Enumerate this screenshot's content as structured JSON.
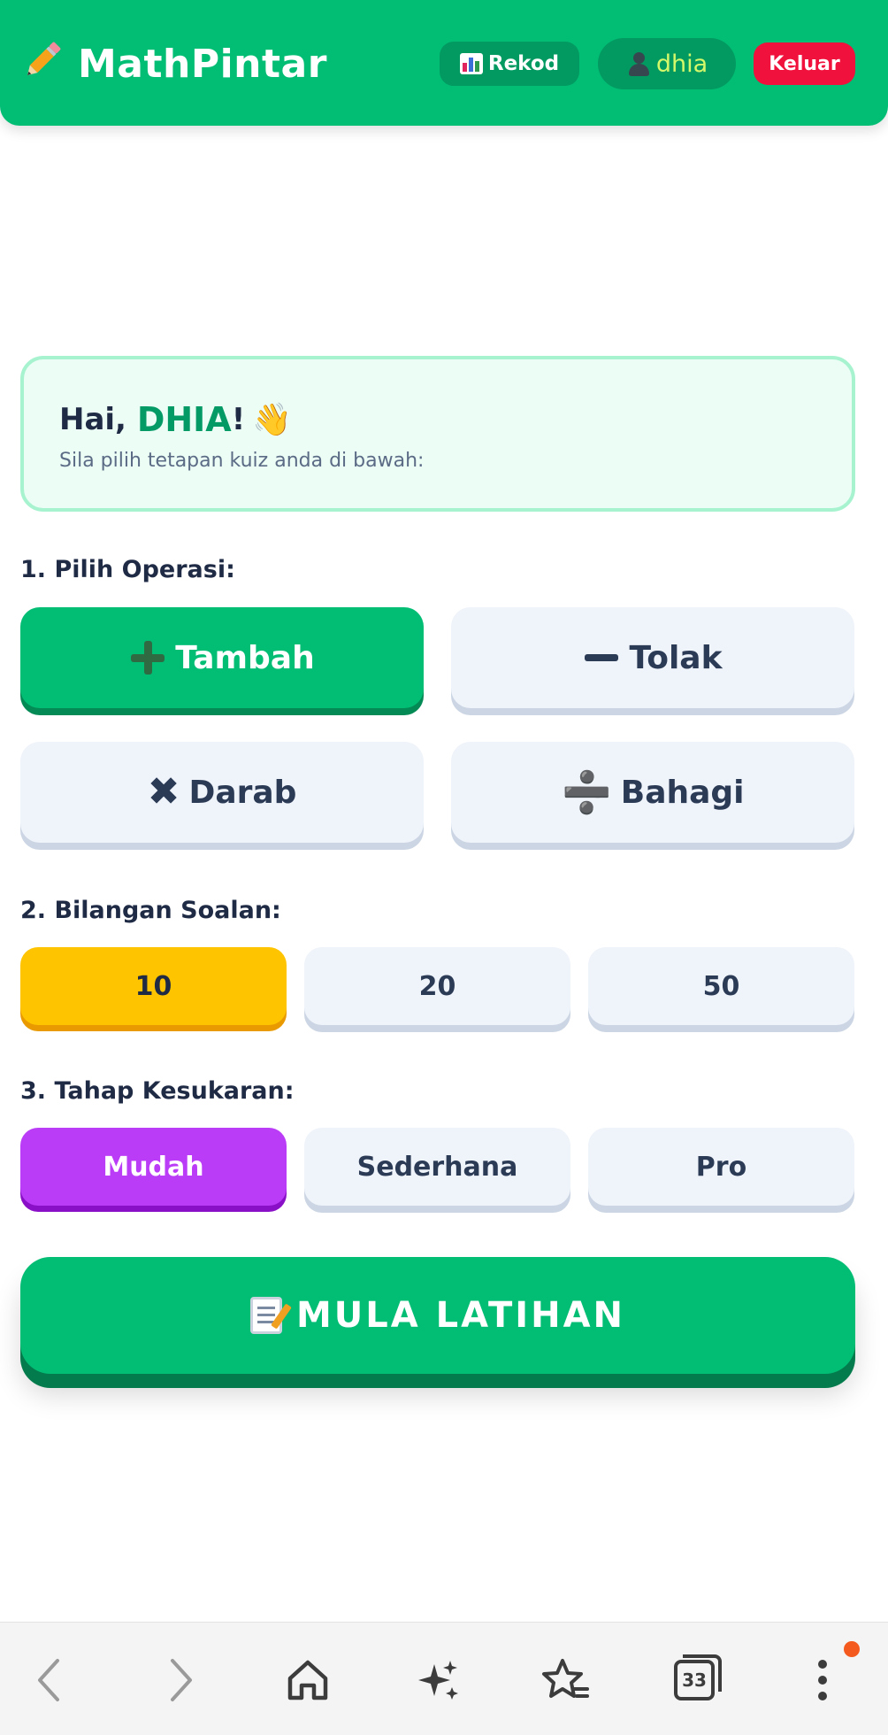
{
  "header": {
    "app_name": "MathPintar",
    "logo_icon": "pencil-icon",
    "rekod_label": "Rekod",
    "user_name": "dhia",
    "logout_label": "Keluar"
  },
  "greeting": {
    "hello": "Hai, ",
    "name": "DHIA",
    "exclaim": "!",
    "subtitle": "Sila pilih tetapan kuiz anda di bawah:"
  },
  "operation": {
    "label": "1. Pilih Operasi:",
    "options": [
      "Tambah",
      "Tolak",
      "Darab",
      "Bahagi"
    ],
    "selected": "Tambah"
  },
  "questions": {
    "label": "2. Bilangan Soalan:",
    "options": [
      "10",
      "20",
      "50"
    ],
    "selected": "10"
  },
  "difficulty": {
    "label": "3. Tahap Kesukaran:",
    "options": [
      "Mudah",
      "Sederhana",
      "Pro"
    ],
    "selected": "Mudah"
  },
  "start_label": "MULA LATIHAN",
  "browser": {
    "tab_count": "33"
  },
  "colors": {
    "primary": "#02bd74",
    "logout": "#f0123c",
    "selected_count": "#ffc400",
    "selected_level": "#bb3cf7"
  }
}
